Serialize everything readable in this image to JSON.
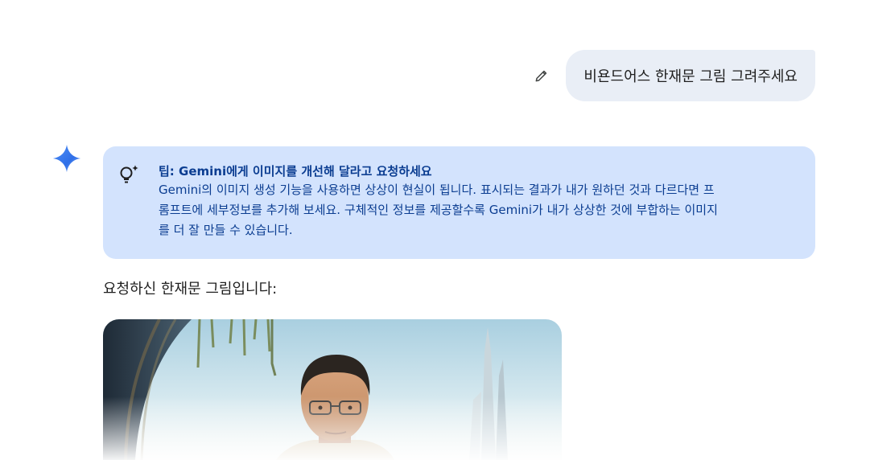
{
  "user_message": {
    "text": "비욘드어스 한재문 그림 그려주세요",
    "edit_icon": "pencil-icon"
  },
  "assistant": {
    "logo_icon": "gemini-sparkle-icon",
    "tip": {
      "icon": "lightbulb-sparkle-icon",
      "title": "팁: Gemini에게 이미지를 개선해 달라고 요청하세요",
      "body_line1": "Gemini의 이미지 생성 기능을 사용하면 상상이 현실이 됩니다. 표시되는 결과가 내가 원하던 것과 다르다면 프",
      "body_line2": "롬프트에 세부정보를 추가해 보세요. 구체적인 정보를 제공할수록 Gemini가 내가 상상한 것에 부합하는 이미지",
      "body_line3": "를 더 잘 만들 수 있습니다."
    },
    "response_text": "요청하신 한재문 그림입니다:",
    "generated_image": "portrait-of-man-with-glasses-futuristic-city"
  },
  "colors": {
    "user_bubble": "#e9eef6",
    "tip_background": "#d3e3fd",
    "tip_text": "#0b3d91",
    "gemini_blue": "#4285f4"
  }
}
